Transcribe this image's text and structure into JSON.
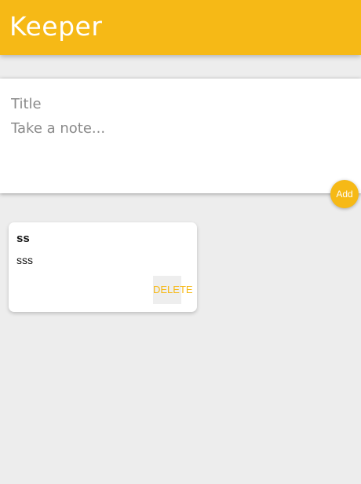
{
  "header": {
    "title": "Keeper"
  },
  "create_note": {
    "title_placeholder": "Title",
    "content_placeholder": "Take a note...",
    "add_label": "Add"
  },
  "notes": [
    {
      "title": "ss",
      "content": "sss",
      "delete_label": "DELETE"
    }
  ],
  "colors": {
    "accent": "#f6b916",
    "background": "#ededed",
    "card": "#ffffff"
  }
}
